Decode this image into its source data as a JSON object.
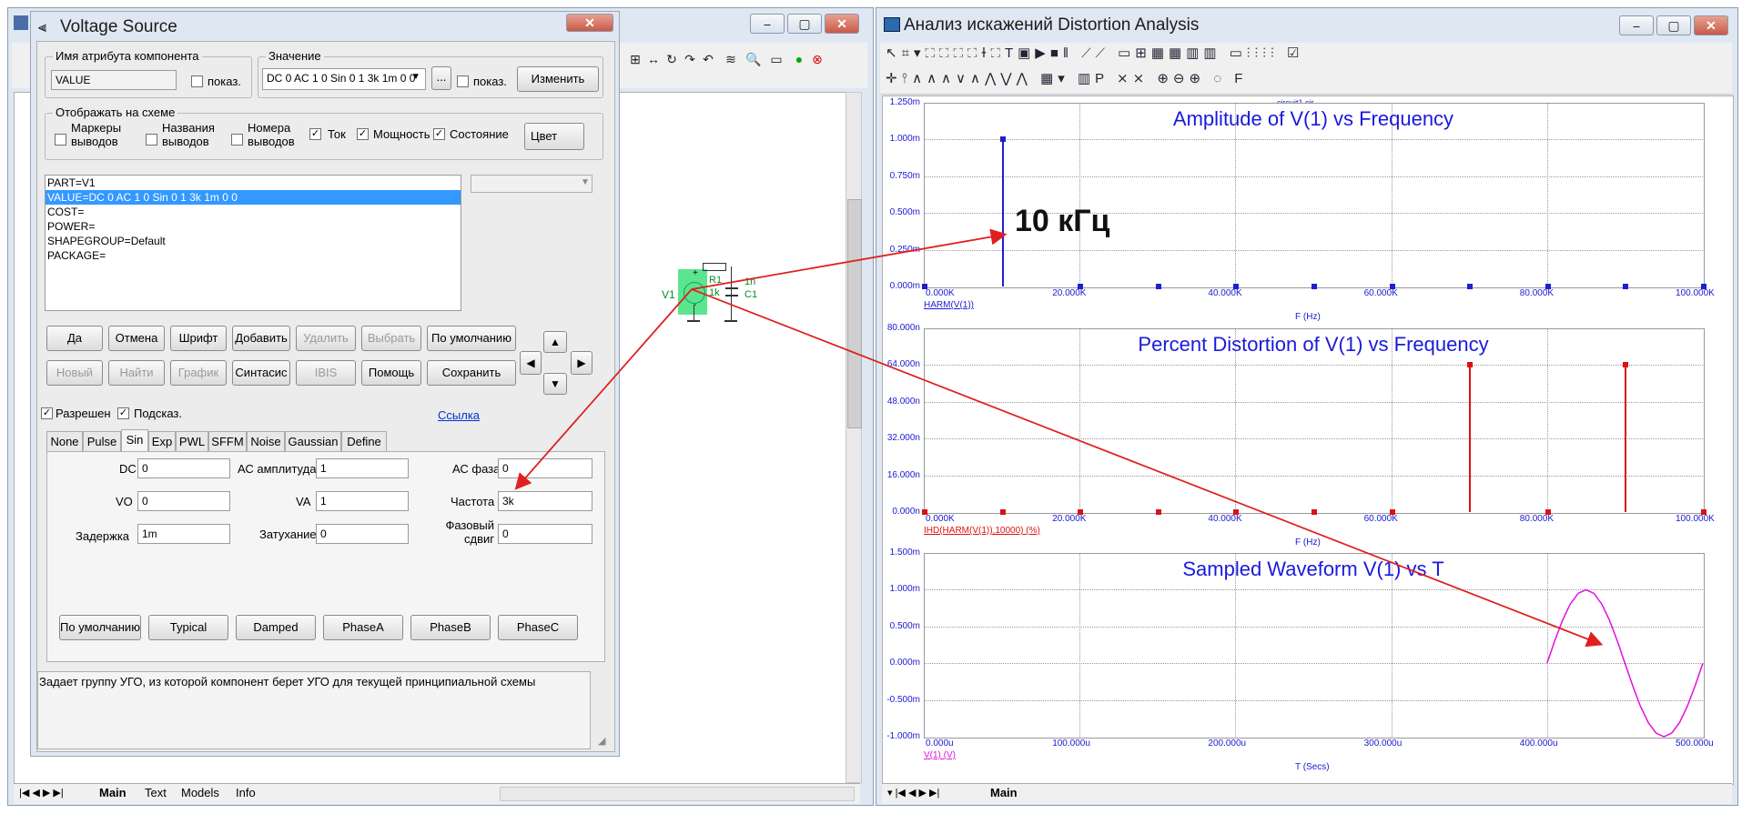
{
  "left_window": {
    "toolbar_icons": [
      "grid-icon",
      "move-icon",
      "rotate-icon",
      "flip-icon",
      "flip-v-icon",
      "wire-icon",
      "find-icon",
      "display-icon",
      "run-icon",
      "stop-icon"
    ],
    "controls": {
      "minimize": "⎯",
      "maximize": "▢",
      "close": "✕"
    }
  },
  "dialog": {
    "title": "Voltage Source",
    "close": "✕",
    "attr_group": "Имя атрибута компонента",
    "attr_value": "VALUE",
    "show1": "показ.",
    "value_group": "Значение",
    "value_text": "DC 0 AC 1 0 Sin 0 1 3k 1m 0 0",
    "browse": "...",
    "show2": "показ.",
    "change": "Изменить",
    "display_group": "Отображать на схеме",
    "cb_markers": "Маркеры выводов",
    "cb_names": "Названия выводов",
    "cb_numbers": "Номера выводов",
    "cb_current": "Ток",
    "cb_power": "Мощность",
    "cb_state": "Состояние",
    "color_btn": "Цвет",
    "attr_list": [
      "PART=V1",
      "VALUE=DC 0 AC 1 0 Sin 0 1 3k 1m 0 0",
      "COST=",
      "POWER=",
      "SHAPEGROUP=Default",
      "PACKAGE="
    ],
    "btn_row1": [
      "Да",
      "Отмена",
      "Шрифт",
      "Добавить",
      "Удалить",
      "Выбрать",
      "По умолчанию"
    ],
    "btn_row2": [
      "Новый",
      "Найти",
      "График",
      "Синтасис",
      "IBIS",
      "Помощь",
      "Сохранить"
    ],
    "enabled": "Разрешен",
    "hints": "Подсказ.",
    "link": "Ссылка",
    "tabs": [
      "None",
      "Pulse",
      "Sin",
      "Exp",
      "PWL",
      "SFFM",
      "Noise",
      "Gaussian",
      "Define"
    ],
    "fields": {
      "dc_label": "DC",
      "dc": "0",
      "ac_amp_label": "АС амплитуда",
      "ac_amp": "1",
      "ac_phase_label": "АС фаза",
      "ac_phase": "0",
      "vo_label": "VO",
      "vo": "0",
      "va_label": "VA",
      "va": "1",
      "freq_label": "Частота",
      "freq": "3k",
      "delay_label": "Задержка",
      "delay": "1m",
      "damp_label": "Затухание",
      "damp": "0",
      "phase_label": "Фазовый сдвиг",
      "phase": "0"
    },
    "btn_row3": [
      "По умолчанию",
      "Typical",
      "Damped",
      "PhaseA",
      "PhaseB",
      "PhaseC"
    ],
    "description": "Задает группу УГО, из которой компонент берет УГО для текущей принципиальной схемы"
  },
  "schematic": {
    "v1": "V1",
    "r1": "R1",
    "r_val": "1k",
    "c1": "C1",
    "c_val": "1n",
    "plus": "+",
    "minus": "-"
  },
  "left_tabs": [
    "Main",
    "Text",
    "Models",
    "Info"
  ],
  "right_window": {
    "title": "Анализ искажений Distortion Analysis",
    "filename": "circuit1.cir",
    "controls": {
      "minimize": "⎯",
      "maximize": "▢",
      "close": "✕"
    },
    "tab": "Main"
  },
  "annotation": "10 кГц",
  "chart_data": [
    {
      "type": "bar",
      "title": "Amplitude of V(1) vs Frequency",
      "xlabel": "F (Hz)",
      "trace_label": "HARM(V(1))",
      "color": "#1f1fd0",
      "x": [
        0,
        10000,
        20000,
        30000,
        40000,
        50000,
        60000,
        70000,
        80000,
        90000,
        100000
      ],
      "y": [
        0,
        1.0,
        0,
        0,
        0,
        0,
        0,
        0,
        0,
        0,
        0
      ],
      "xlim": [
        0,
        100000
      ],
      "ylim": [
        0,
        1.25
      ],
      "yticks": [
        "0.000m",
        "0.250m",
        "0.500m",
        "0.750m",
        "1.000m",
        "1.250m"
      ],
      "xticks": [
        "0.000K",
        "20.000K",
        "40.000K",
        "60.000K",
        "80.000K",
        "100.000K"
      ]
    },
    {
      "type": "bar",
      "title": "Percent Distortion of V(1) vs Frequency",
      "xlabel": "F (Hz)",
      "trace_label": "IHD(HARM(V(1)),10000) (%)",
      "color": "#dd1111",
      "x": [
        0,
        10000,
        20000,
        30000,
        40000,
        50000,
        60000,
        70000,
        80000,
        90000,
        100000
      ],
      "y": [
        0,
        0,
        0,
        0,
        0,
        0,
        0,
        64,
        0,
        64,
        0
      ],
      "xlim": [
        0,
        100000
      ],
      "ylim": [
        0,
        80
      ],
      "yticks": [
        "0.000n",
        "16.000n",
        "32.000n",
        "48.000n",
        "64.000n",
        "80.000n"
      ],
      "xticks": [
        "0.000K",
        "20.000K",
        "40.000K",
        "60.000K",
        "80.000K",
        "100.000K"
      ]
    },
    {
      "type": "line",
      "title": "Sampled Waveform  V(1) vs T",
      "xlabel": "T (Secs)",
      "trace_label": "V(1) (V)",
      "color": "#e010e0",
      "x": [
        400,
        405,
        410,
        415,
        420,
        425,
        430,
        435,
        440,
        445,
        450,
        455,
        460,
        465,
        470,
        475,
        480,
        485,
        490,
        495,
        500
      ],
      "y": [
        0,
        0.309,
        0.588,
        0.809,
        0.951,
        1.0,
        0.951,
        0.809,
        0.588,
        0.309,
        0,
        -0.309,
        -0.588,
        -0.809,
        -0.951,
        -1.0,
        -0.951,
        -0.809,
        -0.588,
        -0.309,
        0
      ],
      "xlim": [
        0,
        500
      ],
      "ylim": [
        -1.0,
        1.5
      ],
      "yticks": [
        "-1.000m",
        "-0.500m",
        "0.000m",
        "0.500m",
        "1.000m",
        "1.500m"
      ],
      "xticks": [
        "0.000u",
        "100.000u",
        "200.000u",
        "300.000u",
        "400.000u",
        "500.000u"
      ]
    }
  ]
}
